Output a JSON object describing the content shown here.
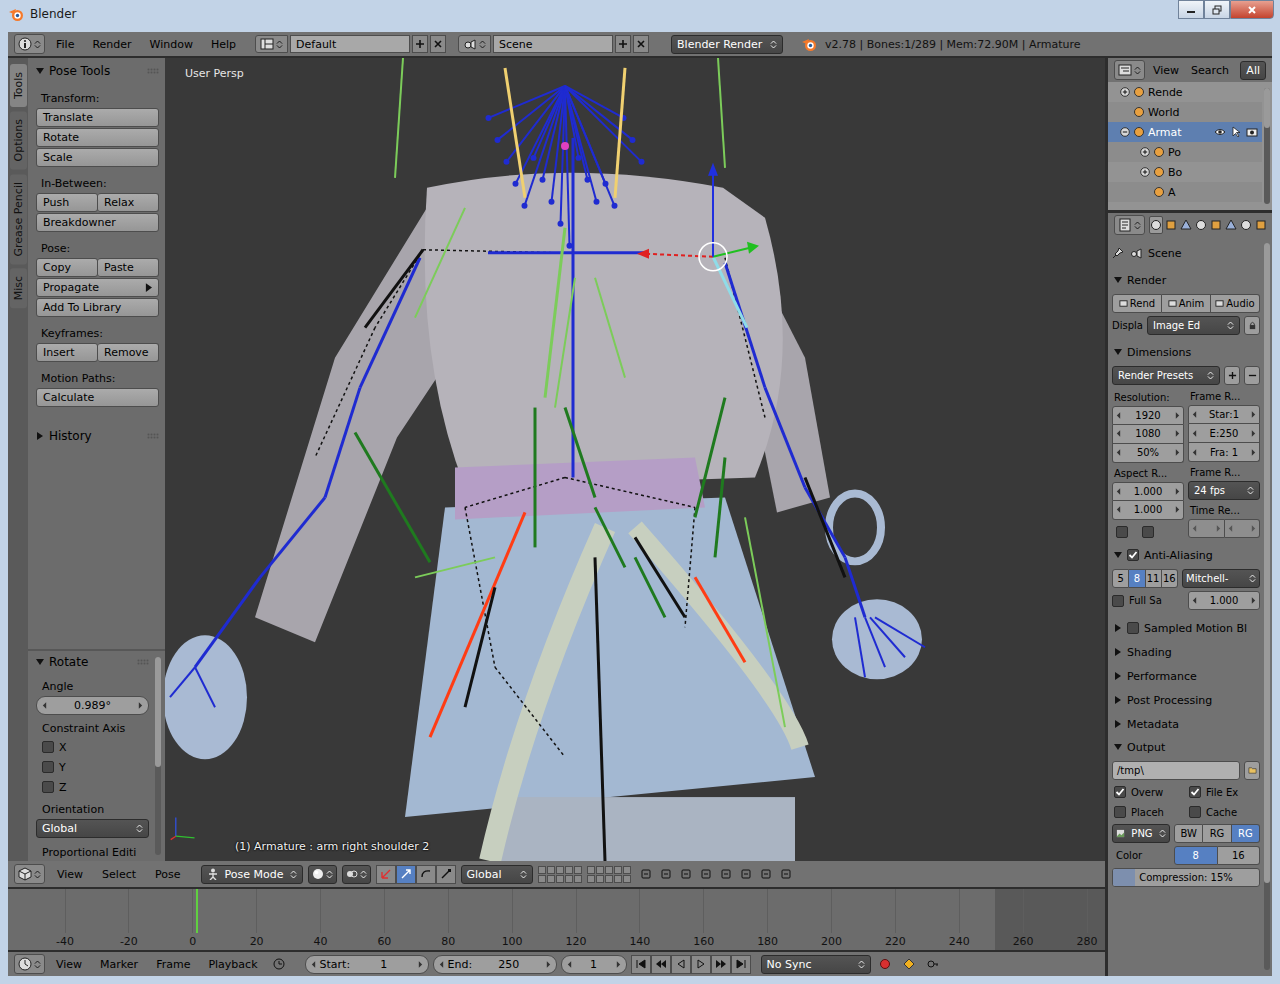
{
  "window": {
    "title": "Blender"
  },
  "info_header": {
    "menus": [
      "File",
      "Render",
      "Window",
      "Help"
    ],
    "layout": "Default",
    "scene": "Scene",
    "engine": "Blender Render",
    "stats": "v2.78 | Bones:1/289 | Mem:72.90M | Armature"
  },
  "tool_tabs": [
    {
      "label": "Tools",
      "selected": true
    },
    {
      "label": "Options",
      "selected": false
    },
    {
      "label": "Grease Pencil",
      "selected": false
    },
    {
      "label": "Misc",
      "selected": false
    }
  ],
  "pose_tools": {
    "title": "Pose Tools",
    "expanded": true,
    "groups": [
      {
        "label": "Transform:",
        "rows": [
          [
            {
              "label": "Translate",
              "kind": "button"
            }
          ],
          [
            {
              "label": "Rotate",
              "kind": "button"
            }
          ],
          [
            {
              "label": "Scale",
              "kind": "button"
            }
          ]
        ]
      },
      {
        "label": "In-Between:",
        "rows": [
          [
            {
              "label": "Push",
              "kind": "button"
            },
            {
              "label": "Relax",
              "kind": "button"
            }
          ],
          [
            {
              "label": "Breakdowner",
              "kind": "button"
            }
          ]
        ]
      },
      {
        "label": "Pose:",
        "rows": [
          [
            {
              "label": "Copy",
              "kind": "button"
            },
            {
              "label": "Paste",
              "kind": "button"
            }
          ],
          [
            {
              "label": "Propagate",
              "kind": "menu"
            }
          ],
          [
            {
              "label": "Add To Library",
              "kind": "button"
            }
          ]
        ]
      },
      {
        "label": "Keyframes:",
        "rows": [
          [
            {
              "label": "Insert",
              "kind": "button"
            },
            {
              "label": "Remove",
              "kind": "button"
            }
          ]
        ]
      },
      {
        "label": "Motion Paths:",
        "rows": [
          [
            {
              "label": "Calculate",
              "kind": "button"
            }
          ]
        ]
      }
    ]
  },
  "history": {
    "title": "History",
    "expanded": false
  },
  "redo_panel": {
    "title": "Rotate",
    "expanded": true,
    "angle_label": "Angle",
    "angle": "0.989°",
    "constraint_label": "Constraint Axis",
    "axes": [
      {
        "label": "X",
        "checked": false
      },
      {
        "label": "Y",
        "checked": false
      },
      {
        "label": "Z",
        "checked": false
      }
    ],
    "orientation_label": "Orientation",
    "orientation": "Global",
    "proportional_label": "Proportional Editi"
  },
  "viewport": {
    "view_name": "User Persp",
    "status": "(1) Armature : arm right shoulder 2"
  },
  "viewport_header": {
    "menus": [
      "View",
      "Select",
      "Pose"
    ],
    "mode": "Pose Mode",
    "orientation": "Global"
  },
  "timeline": {
    "ticks": [
      "-40",
      "-20",
      "0",
      "20",
      "40",
      "60",
      "80",
      "100",
      "120",
      "140",
      "160",
      "180",
      "200",
      "220",
      "240",
      "260",
      "280"
    ],
    "playhead_level": 0.171,
    "range_end_level": 0.9
  },
  "timeline_header": {
    "menus": [
      "View",
      "Marker",
      "Frame",
      "Playback"
    ],
    "start_label": "Start:",
    "start": "1",
    "end_label": "End:",
    "end": "250",
    "current": "1",
    "sync": "No Sync",
    "recording": false
  },
  "outliner": {
    "menus": [
      "View",
      "Search"
    ],
    "filter": "All",
    "items": [
      {
        "label": "Rende",
        "kind": "root",
        "has_children": true,
        "expanded": false,
        "selected": false,
        "show_restrictions": false
      },
      {
        "label": "World",
        "kind": "root",
        "has_children": false,
        "expanded": false,
        "selected": false,
        "show_restrictions": false
      },
      {
        "label": "Armat",
        "kind": "root",
        "has_children": true,
        "expanded": true,
        "selected": true,
        "show_restrictions": true
      },
      {
        "label": "Po",
        "kind": "child",
        "has_children": true,
        "expanded": false,
        "selected": false,
        "show_restrictions": false
      },
      {
        "label": "Bo",
        "kind": "child",
        "has_children": true,
        "expanded": false,
        "selected": false,
        "show_restrictions": false
      },
      {
        "label": "A",
        "kind": "child",
        "has_children": false,
        "expanded": false,
        "selected": false,
        "show_restrictions": false
      }
    ]
  },
  "properties": {
    "tabs": [
      {
        "selected": true
      },
      {
        "selected": false
      },
      {
        "selected": false
      },
      {
        "selected": false
      },
      {
        "selected": false
      },
      {
        "selected": false
      },
      {
        "selected": false
      },
      {
        "selected": false
      }
    ],
    "breadcrumb": "Scene",
    "render": {
      "title": "Render",
      "expanded": true,
      "buttons": [
        "Rend",
        "Anim",
        "Audio"
      ],
      "display_label": "Displa",
      "display": "Image Ed"
    },
    "dimensions": {
      "title": "Dimensions",
      "expanded": true,
      "presets": "Render Presets",
      "resolution_label": "Resolution:",
      "resolution": [
        "1920",
        "1080",
        "50%"
      ],
      "frame_range_label": "Frame R...",
      "frame_range": [
        "Star:1",
        "E:250",
        "Fra: 1"
      ],
      "aspect_label": "Aspect R...",
      "aspect": [
        "1.000",
        "1.000"
      ],
      "frame_rate_label": "Frame R...",
      "frame_rate": "24 fps",
      "time_label": "Time Re...",
      "border": false,
      "crop": false
    },
    "anti_aliasing": {
      "title": "Anti-Aliasing",
      "enabled": true,
      "expanded": true,
      "samples": [
        {
          "label": "5",
          "selected": false
        },
        {
          "label": "8",
          "selected": true
        },
        {
          "label": "11",
          "selected": false
        },
        {
          "label": "16",
          "selected": false
        }
      ],
      "filter": "Mitchell-",
      "full_sample_label": "Full Sa",
      "full_sample": false,
      "size": "1.000"
    },
    "collapsed_panels": [
      {
        "title": "Sampled Motion Bl",
        "kind": "checkbox",
        "checked": false,
        "expanded": false
      },
      {
        "title": "Shading",
        "kind": "plain",
        "expanded": false
      },
      {
        "title": "Performance",
        "kind": "plain",
        "expanded": false
      },
      {
        "title": "Post Processing",
        "kind": "plain",
        "expanded": false
      },
      {
        "title": "Metadata",
        "kind": "plain",
        "expanded": false
      }
    ],
    "output": {
      "title": "Output",
      "expanded": true,
      "path": "/tmp\\",
      "options": [
        {
          "label": "Overw",
          "checked": true
        },
        {
          "label": "File Ex",
          "checked": true
        },
        {
          "label": "Placeh",
          "checked": false
        },
        {
          "label": "Cache",
          "checked": false
        }
      ],
      "format": "PNG",
      "color_modes": [
        {
          "label": "BW",
          "selected": false
        },
        {
          "label": "RG",
          "selected": false
        },
        {
          "label": "RG",
          "selected": true
        }
      ],
      "color_label": "Color",
      "depths": [
        {
          "label": "8",
          "selected": true
        },
        {
          "label": "16",
          "selected": false
        }
      ],
      "compression": "Compression: 15%",
      "compression_level": 0.15
    }
  }
}
